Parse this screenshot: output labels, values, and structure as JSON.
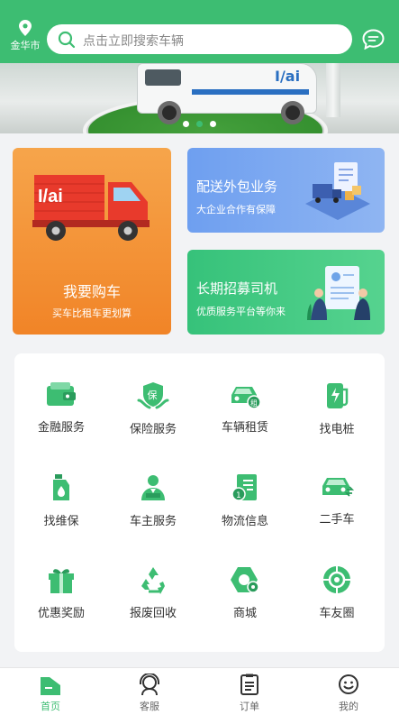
{
  "header": {
    "location": "金华市",
    "search_placeholder": "点击立即搜索车辆"
  },
  "banner": {
    "dots": 3,
    "active_dot": 1
  },
  "cards": {
    "buy": {
      "title": "我要购车",
      "subtitle": "买车比租车更划算"
    },
    "outsource": {
      "title": "配送外包业务",
      "subtitle": "大企业合作有保障"
    },
    "recruit": {
      "title": "长期招募司机",
      "subtitle": "优质服务平台等你来"
    }
  },
  "services": [
    {
      "label": "金融服务",
      "icon": "wallet-icon"
    },
    {
      "label": "保险服务",
      "icon": "insurance-icon"
    },
    {
      "label": "车辆租赁",
      "icon": "car-rental-icon"
    },
    {
      "label": "找电桩",
      "icon": "charging-station-icon"
    },
    {
      "label": "找维保",
      "icon": "maintenance-icon"
    },
    {
      "label": "车主服务",
      "icon": "owner-service-icon"
    },
    {
      "label": "物流信息",
      "icon": "logistics-info-icon"
    },
    {
      "label": "二手车",
      "icon": "used-car-icon"
    },
    {
      "label": "优惠奖励",
      "icon": "gift-icon"
    },
    {
      "label": "报废回收",
      "icon": "recycle-icon"
    },
    {
      "label": "商城",
      "icon": "mall-icon"
    },
    {
      "label": "车友圈",
      "icon": "community-icon"
    }
  ],
  "tabbar": {
    "items": [
      {
        "label": "首页",
        "icon": "home-icon",
        "active": true
      },
      {
        "label": "客服",
        "icon": "customer-service-icon",
        "active": false
      },
      {
        "label": "订单",
        "icon": "order-icon",
        "active": false
      },
      {
        "label": "我的",
        "icon": "profile-icon",
        "active": false
      }
    ]
  },
  "colors": {
    "brand_green": "#3dbd72",
    "orange": "#f18427",
    "blue": "#7aa8f1"
  }
}
